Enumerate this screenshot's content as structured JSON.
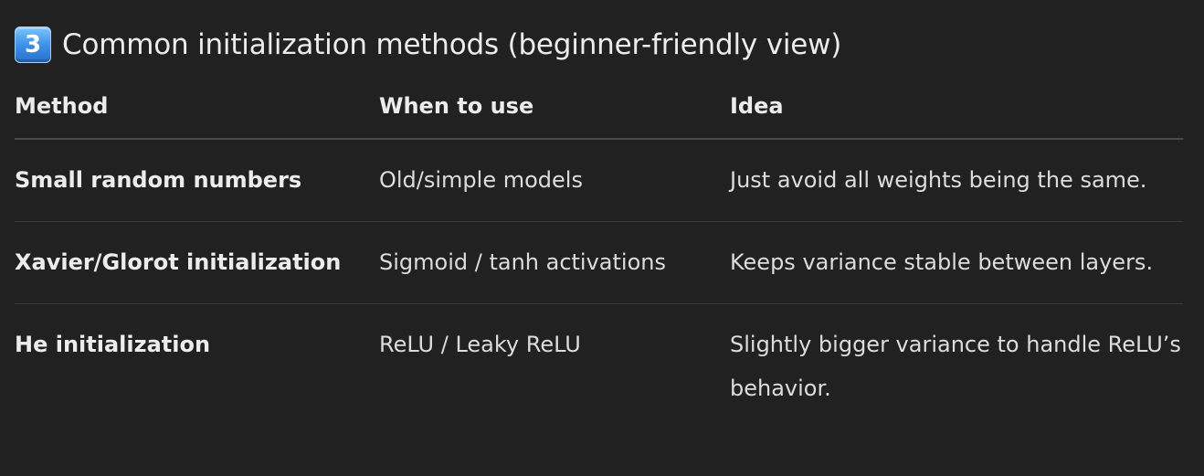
{
  "heading": {
    "keycap_glyph": "3",
    "keycap_icon": "keycap-3-emoji",
    "title": "Common initialization methods (beginner-friendly view)"
  },
  "table": {
    "headers": [
      "Method",
      "When to use",
      "Idea"
    ],
    "rows": [
      {
        "method": "Small random numbers",
        "when": "Old/simple models",
        "idea": "Just avoid all weights being the same."
      },
      {
        "method": "Xavier/Glorot initialization",
        "when": "Sigmoid / tanh activations",
        "idea": "Keeps variance stable between layers."
      },
      {
        "method": "He initialization",
        "when": "ReLU / Leaky ReLU",
        "idea": "Slightly bigger variance to handle ReLU’s behavior."
      }
    ]
  },
  "colors": {
    "background": "#212121",
    "text": "#ececec",
    "keycap": "#3a8ee6"
  }
}
